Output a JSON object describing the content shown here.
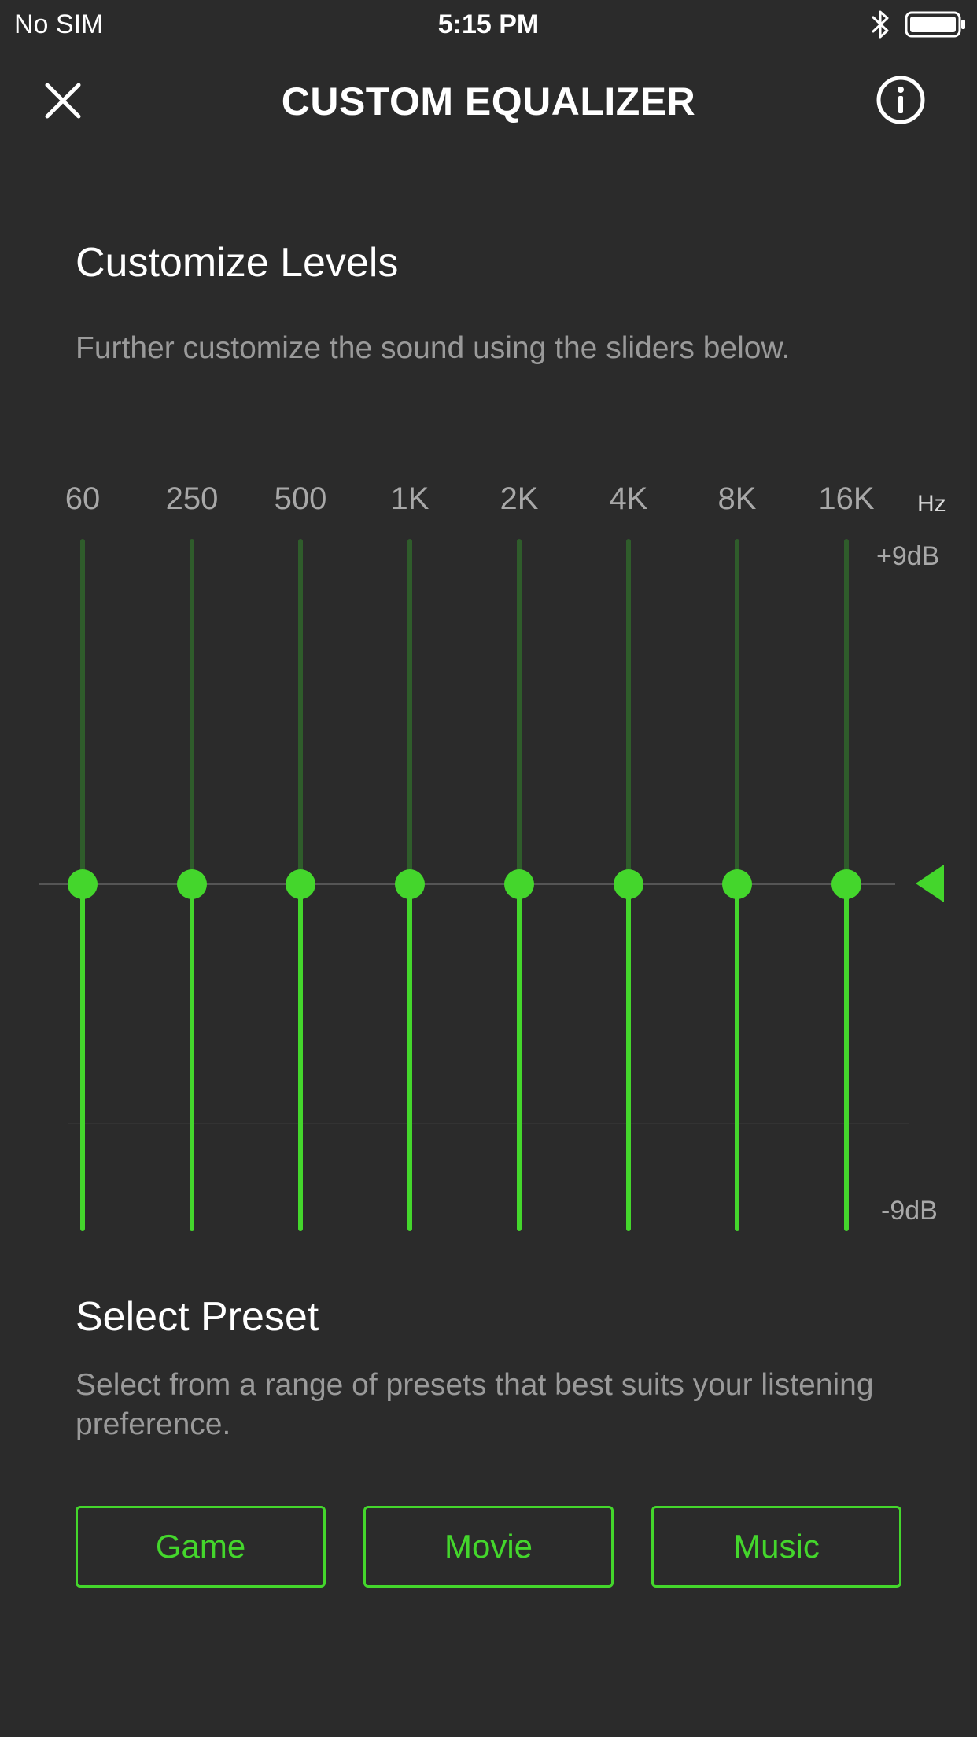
{
  "status_bar": {
    "carrier": "No SIM",
    "time": "5:15 PM",
    "icons": [
      "bluetooth-icon",
      "battery-icon"
    ]
  },
  "header": {
    "title": "CUSTOM EQUALIZER",
    "close_icon": "close-icon",
    "info_icon": "info-icon"
  },
  "levels_section": {
    "title": "Customize Levels",
    "description": "Further customize the sound using the sliders below."
  },
  "equalizer": {
    "unit_label": "Hz",
    "max_label": "+9dB",
    "min_label": "-9dB",
    "bands": [
      {
        "label": "60",
        "gain_db": 0
      },
      {
        "label": "250",
        "gain_db": 0
      },
      {
        "label": "500",
        "gain_db": 0
      },
      {
        "label": "1K",
        "gain_db": 0
      },
      {
        "label": "2K",
        "gain_db": 0
      },
      {
        "label": "4K",
        "gain_db": 0
      },
      {
        "label": "8K",
        "gain_db": 0
      },
      {
        "label": "16K",
        "gain_db": 0
      }
    ]
  },
  "preset_section": {
    "title": "Select Preset",
    "description": "Select from a range of presets that best suits your listening preference.",
    "buttons": [
      "Game",
      "Movie",
      "Music"
    ]
  },
  "colors": {
    "accent": "#44d62c",
    "background": "#2b2b2b",
    "track_inactive": "#2f5c2b",
    "secondary_text": "#9a9a9a"
  }
}
